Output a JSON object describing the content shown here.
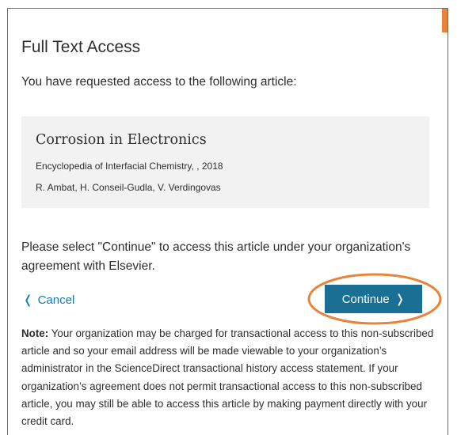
{
  "dialog": {
    "title": "Full Text Access",
    "intro": "You have requested access to the following article:",
    "article": {
      "title": "Corrosion in Electronics",
      "source": "Encyclopedia of Interfacial Chemistry, , 2018",
      "authors": "R. Ambat, H. Conseil-Gudla, V. Verdingovas"
    },
    "instruction": "Please select \"Continue\" to access this article under your organization's agreement with Elsevier.",
    "cancel_label": "Cancel",
    "continue_label": "Continue",
    "note_label": "Note:",
    "note_text": " Your organization may be charged for transactional access to this non-subscribed article and so your email address will be made viewable to your organization’s administrator in the ScienceDirect transactional history access statement. If your organization’s agreement does not permit transactional access to this non-subscribed article, you may still be able to access this article by making payment directly with your credit card."
  },
  "icons": {
    "cancel": "chevron-left-icon",
    "continue": "chevron-right-icon"
  },
  "colors": {
    "accent_blue": "#1a6f94",
    "link_blue": "#0c7dbb",
    "highlight_orange": "#e8833a",
    "card_background": "#f2f2f2"
  }
}
